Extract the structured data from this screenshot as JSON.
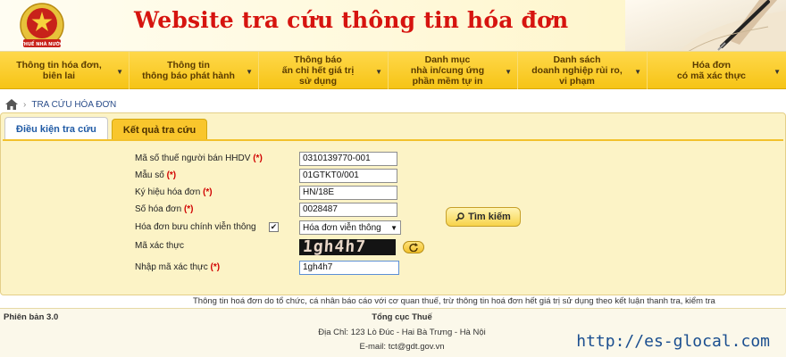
{
  "header": {
    "emblem_text": "THUẾ NHÀ NƯỚC",
    "title": "Website tra cứu thông tin hóa đơn",
    "colors": {
      "title": "#d6140f",
      "nav": "#f6c416"
    }
  },
  "nav": {
    "items": [
      {
        "label": "Thông tin hóa đơn,\nbiên lai"
      },
      {
        "label": "Thông tin\nthông báo phát hành"
      },
      {
        "label": "Thông báo\nấn chỉ hết giá trị\nsử dụng"
      },
      {
        "label": "Danh mục\nnhà in/cung ứng\nphần mềm tự in"
      },
      {
        "label": "Danh sách\ndoanh nghiệp rủi ro,\nvi phạm"
      },
      {
        "label": "Hóa đơn\ncó mã xác thực"
      }
    ]
  },
  "breadcrumb": {
    "current": "TRA CỨU HÓA ĐƠN",
    "icon": "home-icon"
  },
  "tabs": {
    "active": "Điều kiện tra cứu",
    "inactive": "Kết quả tra cứu"
  },
  "form": {
    "seller_tax_code": {
      "label": "Mã số thuế người bán HHDV",
      "required": "(*)",
      "value": "0310139770-001"
    },
    "form_number": {
      "label": "Mẫu số",
      "required": "(*)",
      "value": "01GTKT0/001"
    },
    "invoice_symbol": {
      "label": "Ký hiệu hóa đơn",
      "required": "(*)",
      "value": "HN/18E"
    },
    "invoice_number": {
      "label": "Số hóa đơn",
      "required": "(*)",
      "value": "0028487"
    },
    "telecom_invoice": {
      "label": "Hóa đơn bưu chính viễn thông",
      "checked": "✔",
      "selected": "Hóa đơn viễn thông"
    },
    "captcha": {
      "label": "Mã xác thực",
      "image_text": "1gh4h7"
    },
    "captcha_input": {
      "label": "Nhập mã xác thực",
      "required": "(*)",
      "value": "1gh4h7"
    }
  },
  "search_button": {
    "label": "Tìm kiếm"
  },
  "notice": "Thông tin hoá đơn do tổ chức, cá nhân báo cáo với cơ quan thuế, trừ thông tin hoá đơn hết giá trị sử dụng theo kết luận thanh tra, kiểm tra",
  "footer": {
    "version": "Phiên bản 3.0",
    "org": "Tổng cục Thuế",
    "address": "Địa Chỉ: 123 Lò Đúc - Hai Bà Trưng - Hà Nội",
    "email": "E-mail: tct@gdt.gov.vn"
  },
  "watermark": "http://es-glocal.com"
}
